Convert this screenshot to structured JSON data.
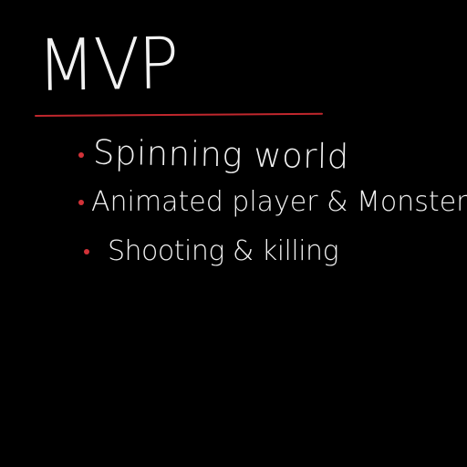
{
  "title": "MVP",
  "accent_color": "#c0272d",
  "background_color": "#000000",
  "text_color": "#f0f0f0",
  "bullets": [
    {
      "text": "Spinning world"
    },
    {
      "text": "Animated player & Monsters"
    },
    {
      "text": "Shooting & killing"
    }
  ]
}
